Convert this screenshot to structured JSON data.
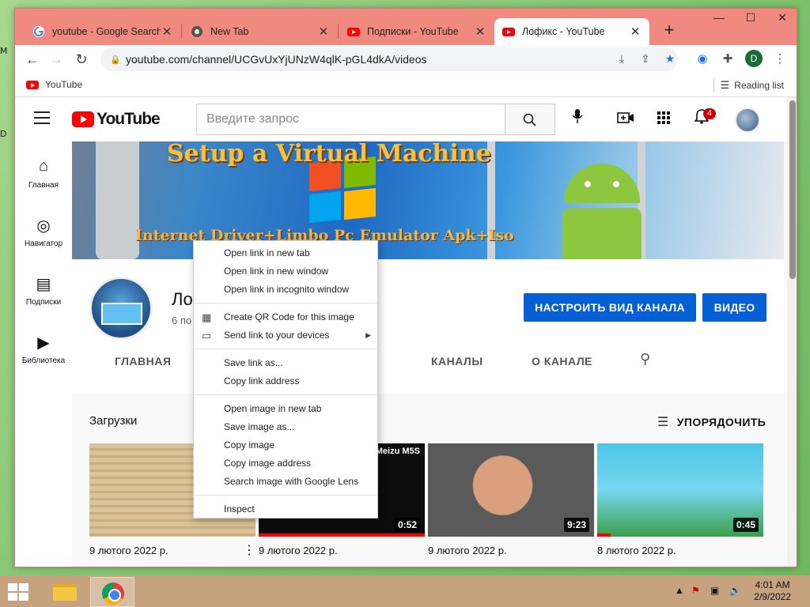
{
  "tabs": [
    {
      "title": "youtube - Google Search",
      "favicon": "google-icon"
    },
    {
      "title": "New Tab",
      "favicon": "chrome-icon"
    },
    {
      "title": "Подписки - YouTube",
      "favicon": "youtube-icon"
    },
    {
      "title": "Лофикс - YouTube",
      "favicon": "youtube-icon",
      "active": true
    }
  ],
  "window_controls": {
    "minimize": "—",
    "maximize": "☐",
    "close": "✕"
  },
  "address_bar": {
    "url": "youtube.com/channel/UCGvUxYjUNzW4qlK-pGL4dkA/videos"
  },
  "profile_initial": "D",
  "bookmarks": {
    "item": "YouTube",
    "reading_list": "Reading list"
  },
  "youtube": {
    "logo_text": "YouTube",
    "search_placeholder": "Введите запрос",
    "notification_count": "4",
    "sidebar": [
      {
        "label": "Главная",
        "icon": "home-icon"
      },
      {
        "label": "Навигатор",
        "icon": "compass-icon"
      },
      {
        "label": "Подписки",
        "icon": "subscriptions-icon"
      },
      {
        "label": "Библиотека",
        "icon": "library-icon"
      }
    ],
    "banner": {
      "title": "Setup a Virtual Machine",
      "subtitle": "Internet Driver+Limbo Pc Emulator Apk+Iso"
    },
    "channel": {
      "name": "Ло",
      "subs": "6 по",
      "customize_button": "НАСТРОИТЬ ВИД КАНАЛА",
      "video_button": "ВИДЕО"
    },
    "channel_tabs": [
      "ГЛАВНАЯ",
      "КАНАЛЫ",
      "О КАНАЛЕ"
    ],
    "uploads_title": "Загрузки",
    "sort_label": "УПОРЯДОЧИТЬ",
    "videos": [
      {
        "date": "9 лютого 2022 р.",
        "duration": ""
      },
      {
        "date": "9 лютого 2022 р.",
        "duration": "0:52",
        "caption": "Meizu M5S"
      },
      {
        "date": "9 лютого 2022 р.",
        "duration": "9:23"
      },
      {
        "date": "8 лютого 2022 р.",
        "duration": "0:45"
      }
    ]
  },
  "context_menu": {
    "items": [
      {
        "label": "Open link in new tab"
      },
      {
        "label": "Open link in new window"
      },
      {
        "label": "Open link in incognito window"
      },
      {
        "label": "Create QR Code for this image",
        "icon": "qr-code-icon"
      },
      {
        "label": "Send link to your devices",
        "icon": "devices-icon",
        "submenu": true
      },
      {
        "label": "Save link as..."
      },
      {
        "label": "Copy link address"
      },
      {
        "label": "Open image in new tab"
      },
      {
        "label": "Save image as..."
      },
      {
        "label": "Copy image"
      },
      {
        "label": "Copy image address"
      },
      {
        "label": "Search image with Google Lens"
      },
      {
        "label": "Inspect"
      }
    ]
  },
  "taskbar": {
    "time": "4:01 AM",
    "date": "2/9/2022"
  },
  "colors": {
    "tab_strip": "#f08a7e",
    "youtube_red": "#ff0000",
    "button_blue": "#065fd4",
    "taskbar": "#c6a37e"
  }
}
